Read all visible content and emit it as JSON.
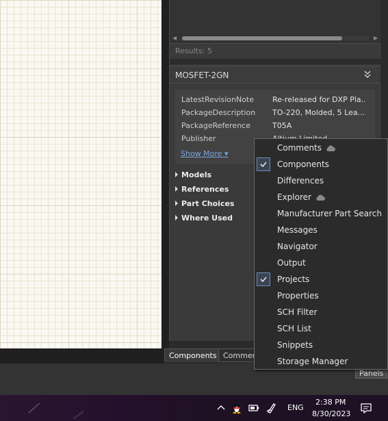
{
  "results": {
    "text": "Results: 5"
  },
  "part": {
    "title": "MOSFET-2GN",
    "properties": [
      {
        "name": "LatestRevisionNote",
        "value": "Re-released for DXP Pla..."
      },
      {
        "name": "PackageDescription",
        "value": "TO-220, Molded, 5 Lea..."
      },
      {
        "name": "PackageReference",
        "value": "T05A"
      },
      {
        "name": "Publisher",
        "value": "Altium Limited"
      }
    ],
    "show_more": "Show More ▾",
    "sections": [
      "Models",
      "References",
      "Part Choices",
      "Where Used"
    ]
  },
  "tabs": [
    {
      "label": "Components",
      "active": true
    },
    {
      "label": "Commen",
      "active": false
    }
  ],
  "panels_button": "Panels",
  "menu": {
    "items": [
      {
        "label": "Comments",
        "checked": false,
        "cloud": true
      },
      {
        "label": "Components",
        "checked": true,
        "cloud": false
      },
      {
        "label": "Differences",
        "checked": false,
        "cloud": false
      },
      {
        "label": "Explorer",
        "checked": false,
        "cloud": true
      },
      {
        "label": "Manufacturer Part Search",
        "checked": false,
        "cloud": false
      },
      {
        "label": "Messages",
        "checked": false,
        "cloud": false
      },
      {
        "label": "Navigator",
        "checked": false,
        "cloud": false
      },
      {
        "label": "Output",
        "checked": false,
        "cloud": false
      },
      {
        "label": "Projects",
        "checked": true,
        "cloud": false
      },
      {
        "label": "Properties",
        "checked": false,
        "cloud": false
      },
      {
        "label": "SCH Filter",
        "checked": false,
        "cloud": false
      },
      {
        "label": "SCH List",
        "checked": false,
        "cloud": false
      },
      {
        "label": "Snippets",
        "checked": false,
        "cloud": false
      },
      {
        "label": "Storage Manager",
        "checked": false,
        "cloud": false
      }
    ]
  },
  "taskbar": {
    "language": "ENG",
    "time": "2:38 PM",
    "date": "8/30/2023"
  },
  "colors": {
    "menu_bg": "#2b2b2b",
    "link": "#79a8e0",
    "checkbox_border": "#6b8fb9"
  }
}
